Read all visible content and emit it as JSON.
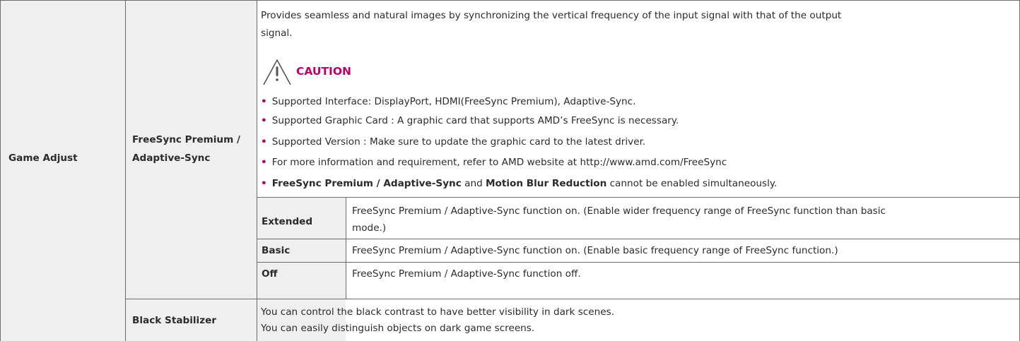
{
  "section_label": "Game Adjust",
  "freesync": {
    "label_line1": "FreeSync Premium /",
    "label_line2": "Adaptive-Sync",
    "desc_line1": "Provides seamless and natural images by synchronizing the vertical frequency of the input signal with that of the output",
    "desc_line2": "signal.",
    "caution_title": "CAUTION",
    "bullets": [
      "Supported Interface: DisplayPort, HDMI(FreeSync Premium), Adaptive-Sync.",
      "Supported Graphic Card : A graphic card that supports AMD’s FreeSync is necessary.",
      "Supported Version : Make sure to update the graphic card to the latest driver.",
      "For more information and requirement, refer to AMD website at http://www.amd.com/FreeSync"
    ],
    "last_bullet": {
      "bold1": "FreeSync Premium / Adaptive-Sync",
      "mid": " and ",
      "bold2": "Motion Blur Reduction",
      "end": " cannot be enabled simultaneously."
    },
    "options": [
      {
        "name": "Extended",
        "desc_line1": "FreeSync Premium / Adaptive-Sync function on. (Enable wider frequency range of FreeSync function than basic",
        "desc_line2": "mode.)"
      },
      {
        "name": "Basic",
        "desc_line1": "FreeSync Premium / Adaptive-Sync function on. (Enable basic frequency range of FreeSync function.)"
      },
      {
        "name": "Off",
        "desc_line1": "FreeSync Premium / Adaptive-Sync function off."
      }
    ]
  },
  "black_stabilizer": {
    "label": "Black Stabilizer",
    "desc_line1": "You can control the black contrast to have better visibility in dark scenes.",
    "desc_line2": "You can easily distinguish objects on dark game screens."
  },
  "colors": {
    "accent": "#c0006a",
    "border": "#6b6b6b",
    "header_bg": "#efefef"
  }
}
